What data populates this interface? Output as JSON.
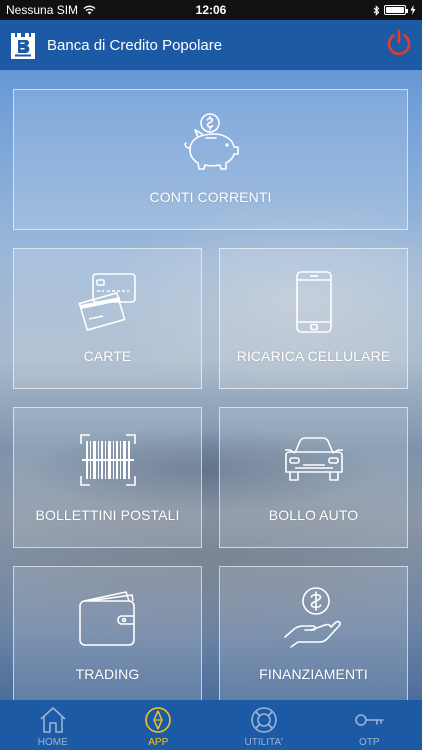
{
  "status_bar": {
    "carrier": "Nessuna SIM",
    "time": "12:06",
    "wifi_icon": "wifi-icon",
    "bluetooth_icon": "bluetooth-icon",
    "battery_icon": "battery-icon",
    "battery_level": 1.0
  },
  "header": {
    "title": "Banca di Credito Popolare",
    "logo_icon": "bank-logo-icon",
    "power_icon": "power-icon",
    "colors": {
      "bar": "#1c5aa6",
      "power": "#e53b2f"
    }
  },
  "tiles": [
    {
      "label": "CONTI CORRENTI",
      "icon": "piggy-bank-icon"
    },
    {
      "label": "CARTE",
      "icon": "credit-cards-icon"
    },
    {
      "label": "RICARICA CELLULARE",
      "icon": "smartphone-icon"
    },
    {
      "label": "BOLLETTINI POSTALI",
      "icon": "barcode-icon"
    },
    {
      "label": "BOLLO AUTO",
      "icon": "car-icon"
    },
    {
      "label": "TRADING",
      "icon": "wallet-icon"
    },
    {
      "label": "FINANZIAMENTI",
      "icon": "money-hand-icon"
    }
  ],
  "tabbar": {
    "active": "APP",
    "colors": {
      "active": "#f4c324",
      "inactive": "#9bb3d4"
    },
    "tabs": [
      {
        "label": "HOME",
        "icon": "home-icon"
      },
      {
        "label": "APP",
        "icon": "compass-icon"
      },
      {
        "label": "UTILITA'",
        "icon": "lifebuoy-icon"
      },
      {
        "label": "OTP",
        "icon": "key-icon"
      }
    ]
  }
}
